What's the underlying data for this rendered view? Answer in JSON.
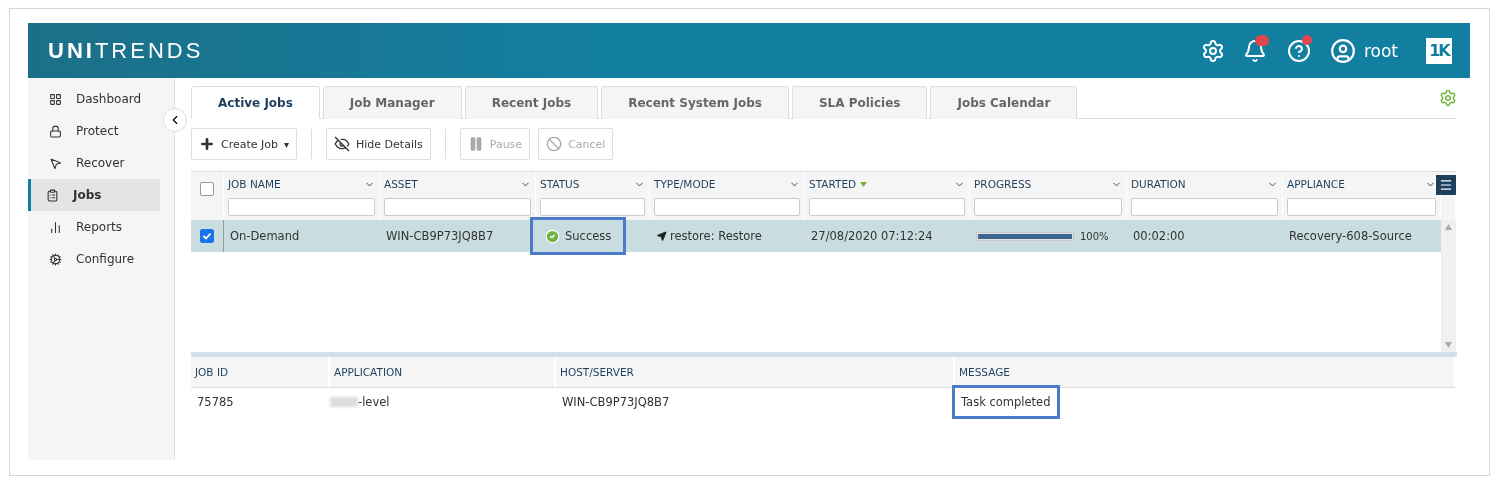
{
  "header": {
    "logo_bold": "UNI",
    "logo_light": "TRENDS",
    "user": "root",
    "notifications_badge": true,
    "help_badge": true,
    "brand_mark": "1K"
  },
  "sidebar": {
    "items": [
      {
        "label": "Dashboard",
        "selected": false
      },
      {
        "label": "Protect",
        "selected": false
      },
      {
        "label": "Recover",
        "selected": false
      },
      {
        "label": "Jobs",
        "selected": true
      },
      {
        "label": "Reports",
        "selected": false
      },
      {
        "label": "Configure",
        "selected": false
      }
    ]
  },
  "tabs": [
    {
      "label": "Active Jobs",
      "selected": true
    },
    {
      "label": "Job Manager",
      "selected": false
    },
    {
      "label": "Recent Jobs",
      "selected": false
    },
    {
      "label": "Recent System Jobs",
      "selected": false
    },
    {
      "label": "SLA Policies",
      "selected": false
    },
    {
      "label": "Jobs Calendar",
      "selected": false
    }
  ],
  "toolbar": [
    {
      "label": "Create Job",
      "caret": "▾",
      "disabled": false
    },
    {
      "label": "Hide Details",
      "disabled": false
    },
    {
      "label": "Pause",
      "disabled": true
    },
    {
      "label": "Cancel",
      "disabled": true
    }
  ],
  "jobs_table": {
    "all_checked": false,
    "columns": [
      {
        "label": "JOB NAME",
        "sorted": false
      },
      {
        "label": "ASSET",
        "sorted": false
      },
      {
        "label": "STATUS",
        "sorted": false
      },
      {
        "label": "TYPE/MODE",
        "sorted": false
      },
      {
        "label": "STARTED",
        "sorted": true
      },
      {
        "label": "PROGRESS",
        "sorted": false
      },
      {
        "label": "DURATION",
        "sorted": false
      },
      {
        "label": "APPLIANCE",
        "sorted": false
      }
    ],
    "rows": [
      {
        "checked": true,
        "selected": true,
        "job_name": "On-Demand",
        "asset": "WIN-CB9P73JQ8B7",
        "status": "Success",
        "status_highlighted": true,
        "type_mode": "restore: Restore",
        "started": "27/08/2020 07:12:24",
        "progress": {
          "level": 1,
          "reading": "100%"
        },
        "duration": "00:02:00",
        "appliance": "Recovery-608-Source"
      }
    ]
  },
  "details_table": {
    "columns": [
      "JOB ID",
      "APPLICATION",
      "HOST/SERVER",
      "MESSAGE"
    ],
    "rows": [
      {
        "job_id": "75785",
        "application": "-level",
        "application_redacted": true,
        "host": "WIN-CB9P73JQ8B7",
        "message": "Task completed",
        "message_highlighted": true
      }
    ]
  }
}
